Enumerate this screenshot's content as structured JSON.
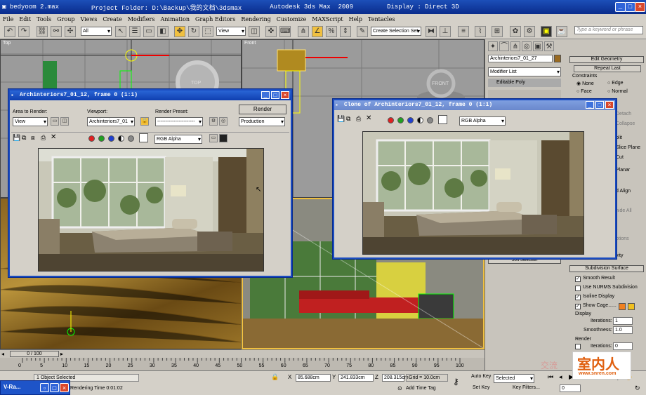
{
  "titlebar": {
    "file": "bedyoom 2.max",
    "folder": "Project Folder: D:\\Backup\\我的文档\\3dsmax",
    "app": "Autodesk 3ds Max  2009",
    "display": "Display : Direct 3D"
  },
  "menu": [
    "File",
    "Edit",
    "Tools",
    "Group",
    "Views",
    "Create",
    "Modifiers",
    "Animation",
    "Graph Editors",
    "Rendering",
    "Customize",
    "MAXScript",
    "Help",
    "Tentacles"
  ],
  "toolbar": {
    "selection_filter": "All",
    "ref_coord": "View",
    "named_selection": "Create Selection Set",
    "search_placeholder": "Type a keyword or phrase"
  },
  "viewports": {
    "top": "Top",
    "front": "Front",
    "top_cube": "TOP",
    "front_cube": "FRONT"
  },
  "command_panel": {
    "object_name": "Archinteriors7_01_27",
    "modifier_list": "Modifier List",
    "stack_item": "Editable Poly",
    "edit_geometry": "Edit Geometry",
    "repeat_last": "Repeat Last",
    "constraints": "Constraints",
    "c_none": "None",
    "c_edge": "Edge",
    "c_face": "Face",
    "c_normal": "Normal",
    "partial": [
      "Slice Plane",
      "Cut",
      "Relax",
      "Collapse",
      "Detach",
      "Split",
      "Planar",
      "Hide All",
      "Selection",
      "Soft Selection"
    ],
    "subdiv": "Subdivision Surface",
    "smooth_result": "Smooth Result",
    "use_nurms": "Use NURMS Subdivision",
    "isoline": "Isoline Display",
    "show_cage": "Show Cage......",
    "display": "Display",
    "iterations_label": "Iterations:",
    "iterations_val": "1",
    "smoothness_label": "Smoothness:",
    "smoothness_val": "1.0",
    "render": "Render",
    "r_iterations_val": "0",
    "soft_sel": "Soft Selection",
    "gravity": "vity",
    "options": "ptions",
    "align": "d Align",
    "plit": "plit",
    "hide": "nide All"
  },
  "render_window": {
    "title": "Archinteriors7_01_12, frame 0 (1:1)",
    "area_label": "Area to Render:",
    "area_value": "View",
    "viewport_label": "Viewport:",
    "viewport_value": "Archinteriors7_01",
    "preset_label": "Render Preset:",
    "preset_value": "-----------------------",
    "render_button": "Render",
    "mode_value": "Production",
    "channel": "RGB Alpha"
  },
  "clone_window": {
    "title": "Clone of Archinteriors7_01_12, frame 0 (1:1)",
    "channel": "RGB Alpha"
  },
  "timeline": {
    "frame": "0 / 100",
    "ticks": [
      "0",
      "5",
      "10",
      "15",
      "20",
      "25",
      "30",
      "35",
      "40",
      "45",
      "50",
      "55",
      "60",
      "65",
      "70",
      "75",
      "80",
      "85",
      "90",
      "95",
      "100"
    ]
  },
  "status": {
    "selected": "1 Object Selected",
    "render_time": "Rendering Time  0:01:02",
    "x": "85.688cm",
    "y": "241.833cm",
    "z": "208.315cm",
    "grid": "Grid = 10.0cm",
    "add_time_tag": "Add Time Tag",
    "auto_key": "Auto Key",
    "set_key": "Set Key",
    "key_mode": "Selected",
    "key_filters": "Key Filters...",
    "frame_field": "0"
  },
  "taskbar": {
    "item": "V-Ra..."
  },
  "watermark": {
    "main": "室内人",
    "url": "www.snren.com",
    "faint": "交流"
  }
}
